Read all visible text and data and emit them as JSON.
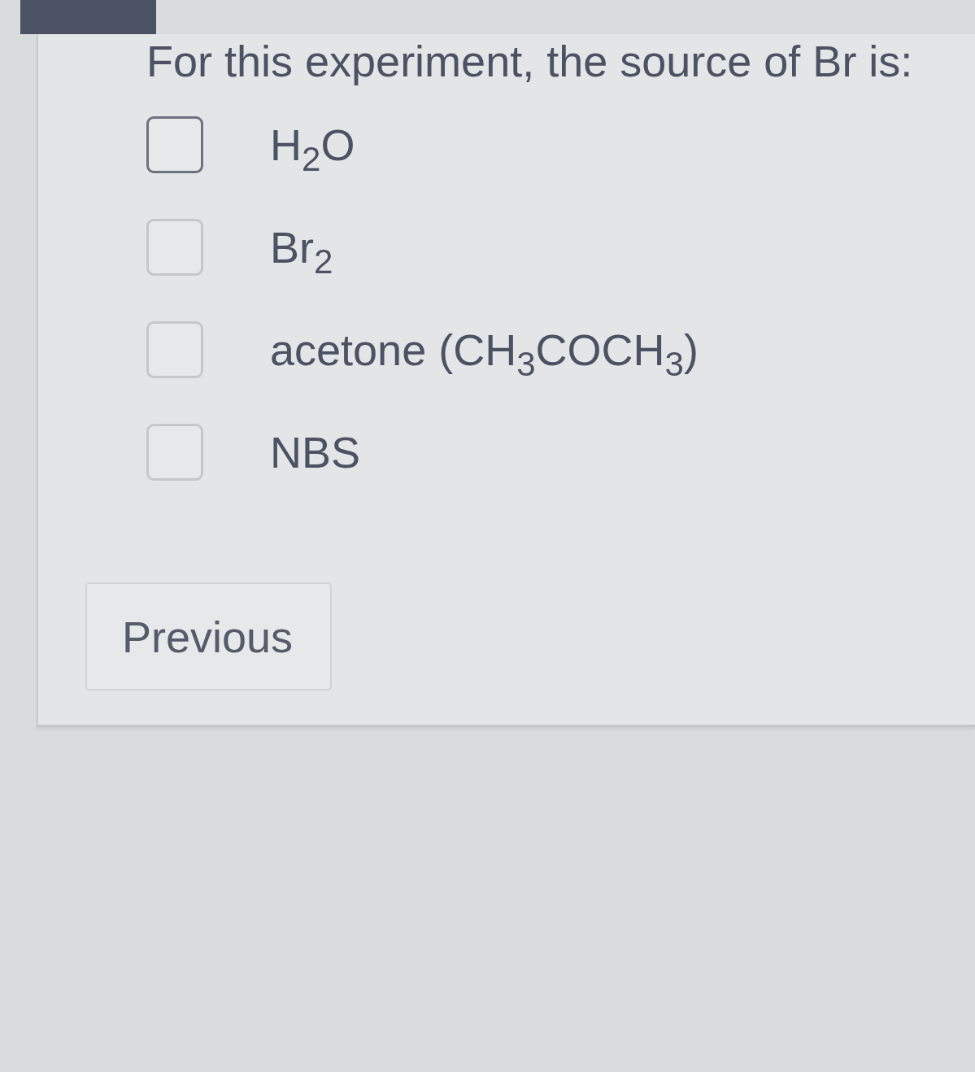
{
  "question": {
    "text": "For this experiment, the source of Br is:"
  },
  "options": [
    {
      "label": "H$_{2}$O",
      "checked": false,
      "focused": true
    },
    {
      "label": "Br$_{2}$",
      "checked": false,
      "focused": false
    },
    {
      "label": "acetone (CH$_{3}$COCH$_{3}$)",
      "checked": false,
      "focused": false
    },
    {
      "label": "NBS",
      "checked": false,
      "focused": false
    }
  ],
  "buttons": [
    {
      "label": "Previous"
    }
  ]
}
